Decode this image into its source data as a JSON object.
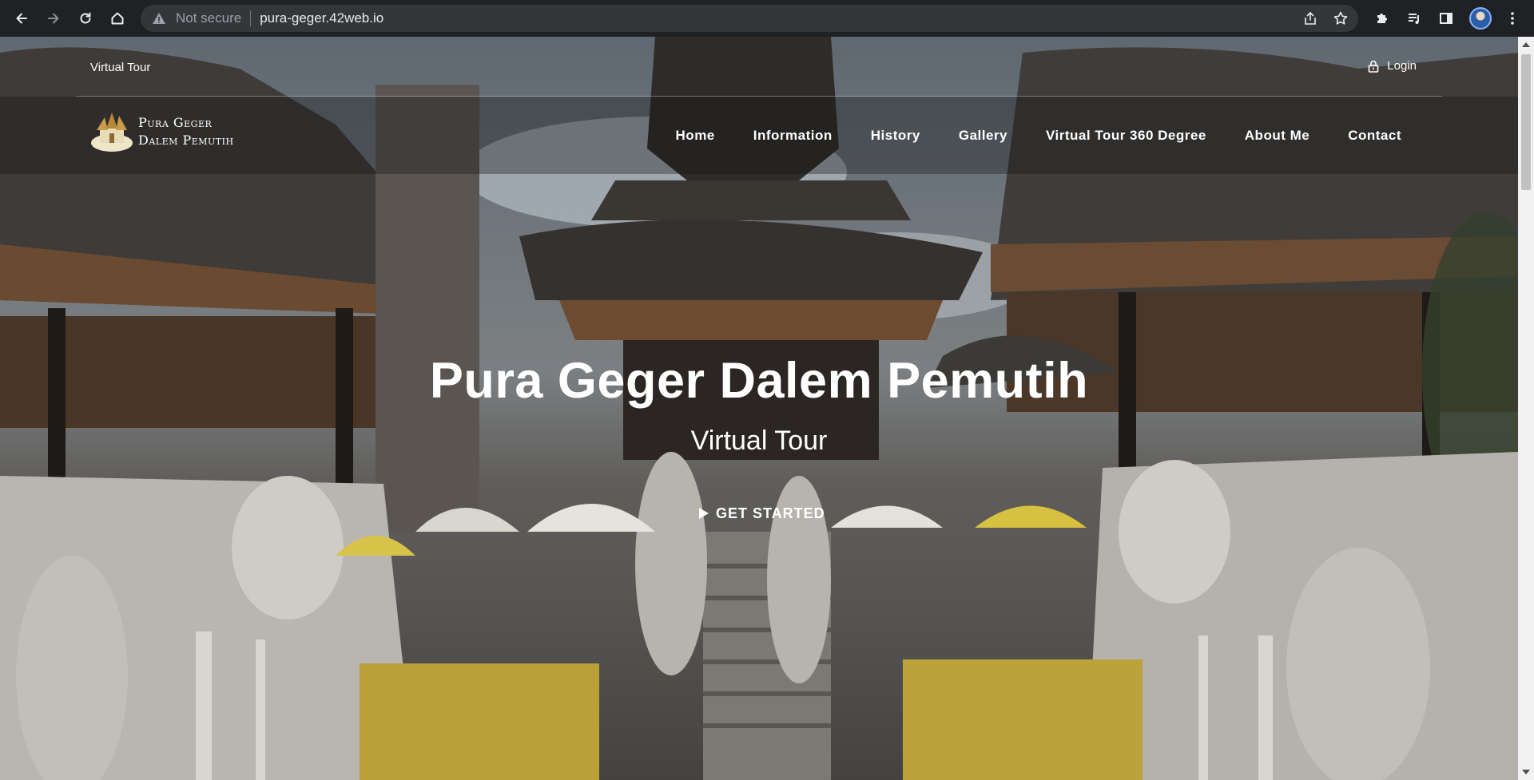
{
  "browser": {
    "security_label": "Not secure",
    "url": "pura-geger.42web.io",
    "icons": [
      "back-icon",
      "forward-icon",
      "reload-icon",
      "home-icon",
      "warning-icon",
      "share-icon",
      "bookmark-star-icon",
      "extensions-icon",
      "media-icon",
      "side-panel-icon",
      "profile-avatar",
      "menu-kebab-icon"
    ]
  },
  "site": {
    "topbar": {
      "left_text": "Virtual Tour",
      "login_label": "Login"
    },
    "logo": {
      "line1": "Pura Geger",
      "line2": "Dalem Pemutih"
    },
    "nav": [
      {
        "label": "Home"
      },
      {
        "label": "Information"
      },
      {
        "label": "History"
      },
      {
        "label": "Gallery"
      },
      {
        "label": "Virtual Tour 360 Degree"
      },
      {
        "label": "About Me"
      },
      {
        "label": "Contact"
      }
    ],
    "hero": {
      "title": "Pura Geger Dalem Pemutih",
      "subtitle": "Virtual Tour",
      "cta_label": "GET STARTED"
    }
  }
}
